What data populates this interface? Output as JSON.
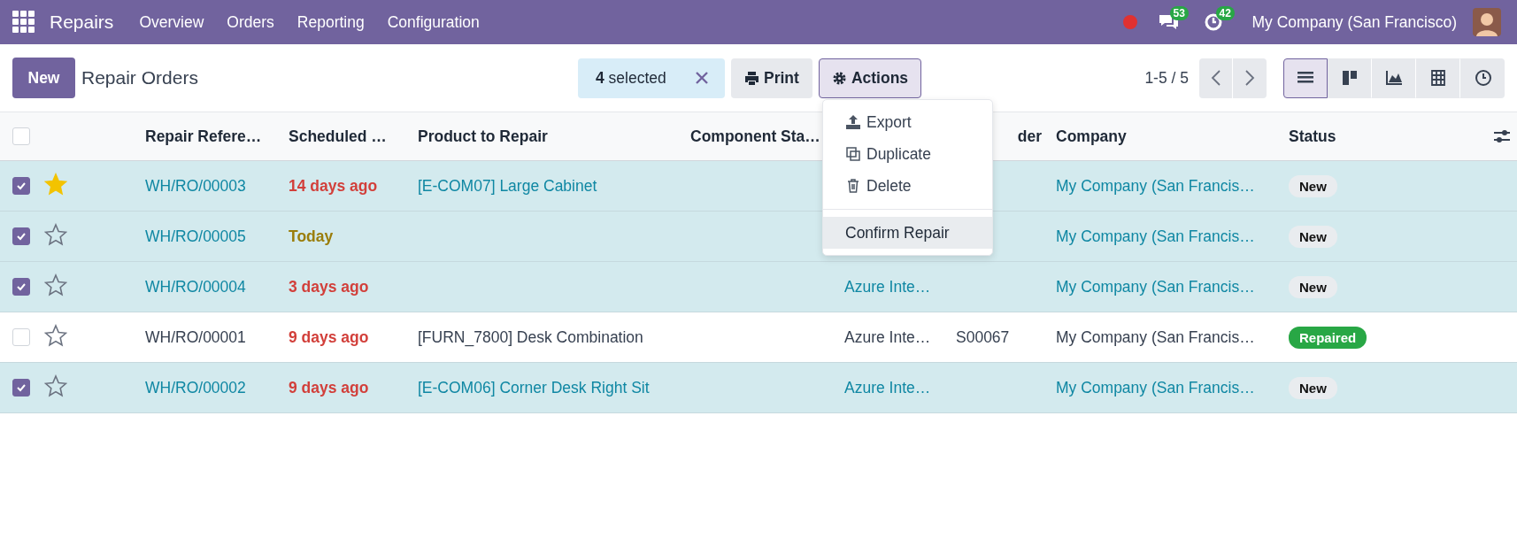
{
  "navbar": {
    "app": "Repairs",
    "menu": [
      "Overview",
      "Orders",
      "Reporting",
      "Configuration"
    ],
    "chat_count": "53",
    "activity_count": "42",
    "company": "My Company (San Francisco)"
  },
  "toolbar": {
    "new_label": "New",
    "title": "Repair Orders",
    "selection": "**4** selected",
    "print_label": "Print",
    "actions_label": "Actions",
    "actions_open": true,
    "pager": "1-5 / 5",
    "views": [
      {
        "kind": "list",
        "selected": true
      },
      {
        "kind": "kanban",
        "selected": false
      },
      {
        "kind": "graph",
        "selected": false
      },
      {
        "kind": "pivot",
        "selected": false
      },
      {
        "kind": "activity",
        "selected": false
      }
    ]
  },
  "action_menu": {
    "sections": [
      {
        "items": [
          {
            "kind": "export",
            "label": "Export",
            "selected": false
          },
          {
            "kind": "duplicate",
            "label": "Duplicate",
            "selected": false
          },
          {
            "kind": "delete",
            "label": "Delete",
            "selected": false
          }
        ]
      },
      {
        "items": [
          {
            "kind": "action",
            "label": "Confirm Repair",
            "selected": true
          }
        ]
      }
    ]
  },
  "table": {
    "all_checked": false,
    "columns": [
      "Repair Refere…",
      "Scheduled …",
      "Product to Repair",
      "Component Sta…",
      "",
      "der",
      "Company",
      "Status"
    ],
    "rows": [
      {
        "selected": true,
        "starred": true,
        "reference": "WH/RO/00003",
        "scheduled": {
          "text": "14 days ago",
          "kind": "overdue"
        },
        "product": "[E-COM07] Large Cabinet",
        "company": "My Company (San Francis…",
        "status": {
          "label": "New",
          "kind": "new"
        }
      },
      {
        "selected": true,
        "starred": false,
        "reference": "WH/RO/00005",
        "scheduled": {
          "text": "Today",
          "kind": "today"
        },
        "company": "My Company (San Francis…",
        "status": {
          "label": "New",
          "kind": "new"
        }
      },
      {
        "selected": true,
        "starred": false,
        "reference": "WH/RO/00004",
        "scheduled": {
          "text": "3 days ago",
          "kind": "overdue"
        },
        "column_5": "Azure Inte…",
        "company": "My Company (San Francis…",
        "status": {
          "label": "New",
          "kind": "new"
        }
      },
      {
        "selected": false,
        "starred": false,
        "reference": "WH/RO/00001",
        "scheduled": {
          "text": "9 days ago",
          "kind": "overdue"
        },
        "product": "[FURN_7800] Desk Combination",
        "column_5": "Azure Inte…",
        "column_6": "S00067",
        "company": "My Company (San Francis…",
        "status": {
          "label": "Repaired",
          "kind": "done"
        }
      },
      {
        "selected": true,
        "starred": false,
        "reference": "WH/RO/00002",
        "scheduled": {
          "text": "9 days ago",
          "kind": "overdue"
        },
        "product": "[E-COM06] Corner Desk Right Sit",
        "column_5": "Azure Inte…",
        "company": "My Company (San Francis…",
        "status": {
          "label": "New",
          "kind": "new"
        }
      }
    ]
  }
}
